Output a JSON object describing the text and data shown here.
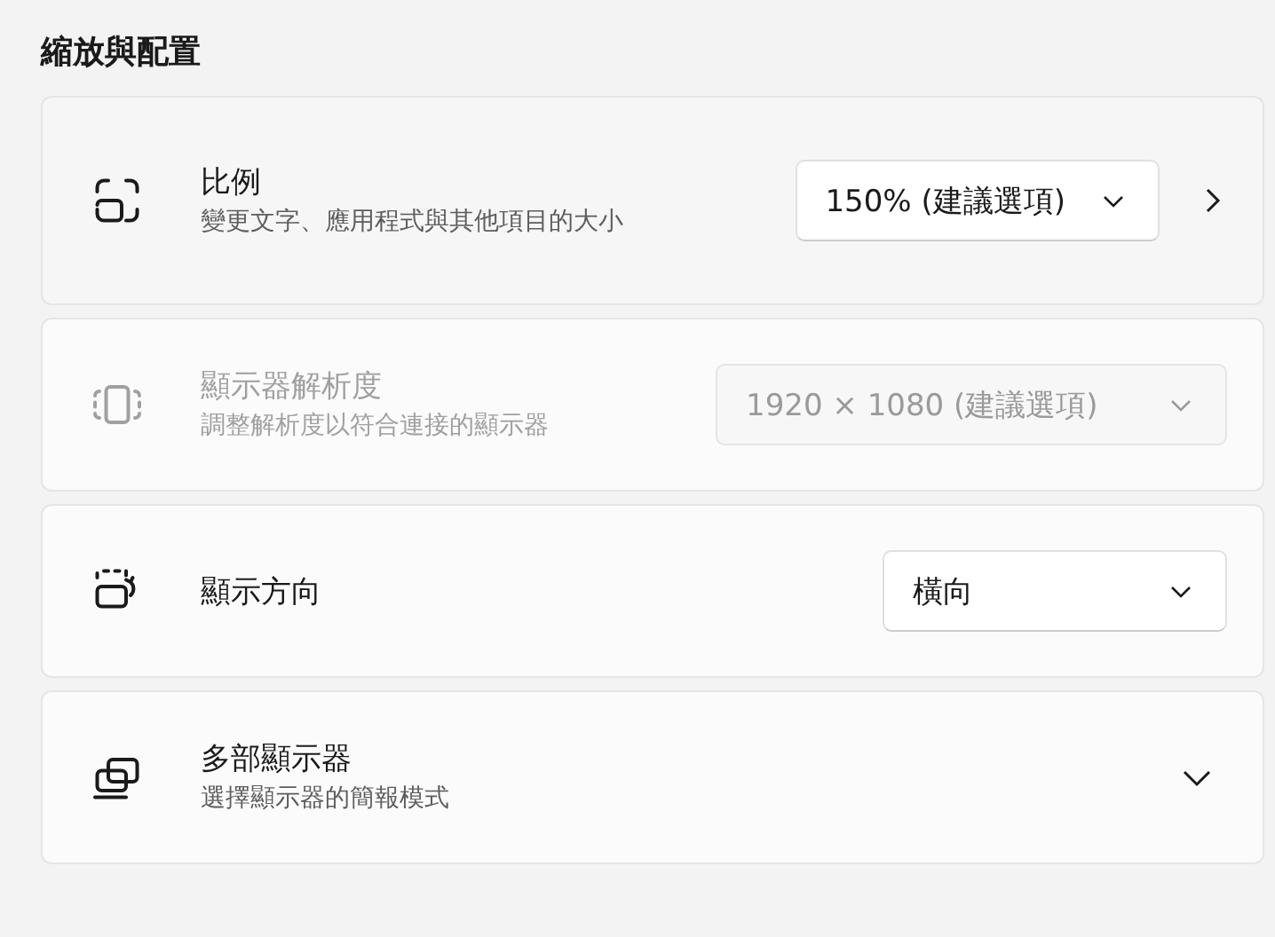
{
  "heading": "縮放與配置",
  "rows": [
    {
      "kind": "dropdown-link",
      "title": "比例",
      "subtitle": "變更文字、應用程式與其他項目的大小",
      "value": "150% (建議選項)",
      "disabled": false
    },
    {
      "kind": "dropdown",
      "title": "顯示器解析度",
      "subtitle": "調整解析度以符合連接的顯示器",
      "value": "1920 × 1080 (建議選項)",
      "disabled": true
    },
    {
      "kind": "dropdown",
      "title": "顯示方向",
      "value": "橫向",
      "disabled": false
    },
    {
      "kind": "expander",
      "title": "多部顯示器",
      "subtitle": "選擇顯示器的簡報模式",
      "disabled": false,
      "expanded": false
    }
  ]
}
